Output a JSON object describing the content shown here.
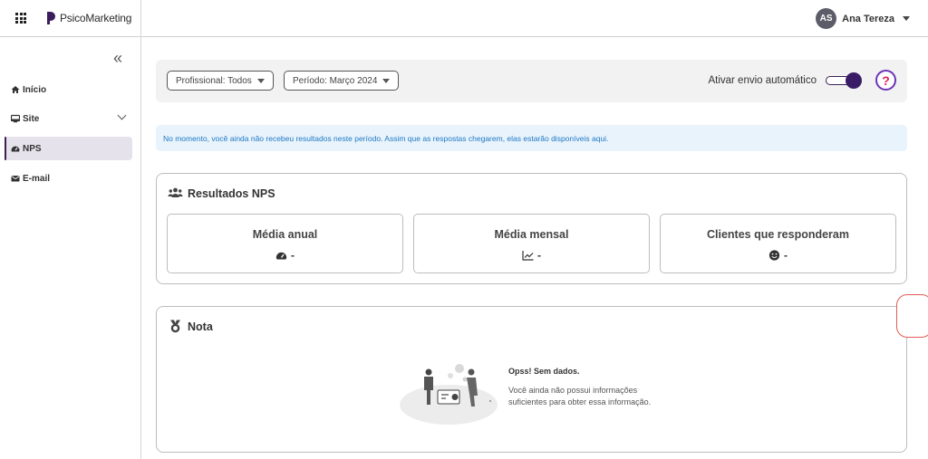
{
  "header": {
    "brand_name": "PsicoMarketing",
    "user_initials": "AS",
    "user_name": "Ana Tereza"
  },
  "sidebar": {
    "collapse_glyph": "«",
    "items": [
      {
        "label": "Início",
        "icon": "home-icon"
      },
      {
        "label": "Site",
        "icon": "monitor-icon",
        "expandable": true
      },
      {
        "label": "NPS",
        "icon": "gauge-icon",
        "active": true
      },
      {
        "label": "E-mail",
        "icon": "envelope-icon"
      }
    ]
  },
  "filters": {
    "professional_label": "Profissional: Todos",
    "period_label": "Período: Março 2024",
    "auto_send_label": "Ativar envio automático",
    "auto_send_on": true,
    "help_glyph": "?"
  },
  "info_message": "No momento, você ainda não recebeu resultados neste período. Assim que as respostas chegarem, elas estarão disponíveis aqui.",
  "nps_card": {
    "title": "Resultados NPS",
    "stats": [
      {
        "label": "Média anual",
        "value": "-",
        "icon": "gauge-icon"
      },
      {
        "label": "Média mensal",
        "value": "-",
        "icon": "chart-line-icon"
      },
      {
        "label": "Clientes que responderam",
        "value": "-",
        "icon": "smile-icon"
      }
    ]
  },
  "nota_card": {
    "title": "Nota",
    "empty_title": "Opss! Sem dados.",
    "empty_text": "Você ainda não possui informações suficientes para obter essa informação."
  },
  "colors": {
    "primary": "#3a1c66",
    "info_bg": "#e8f3fc",
    "info_text": "#1f78c4",
    "help_accent": "#e2205a"
  }
}
